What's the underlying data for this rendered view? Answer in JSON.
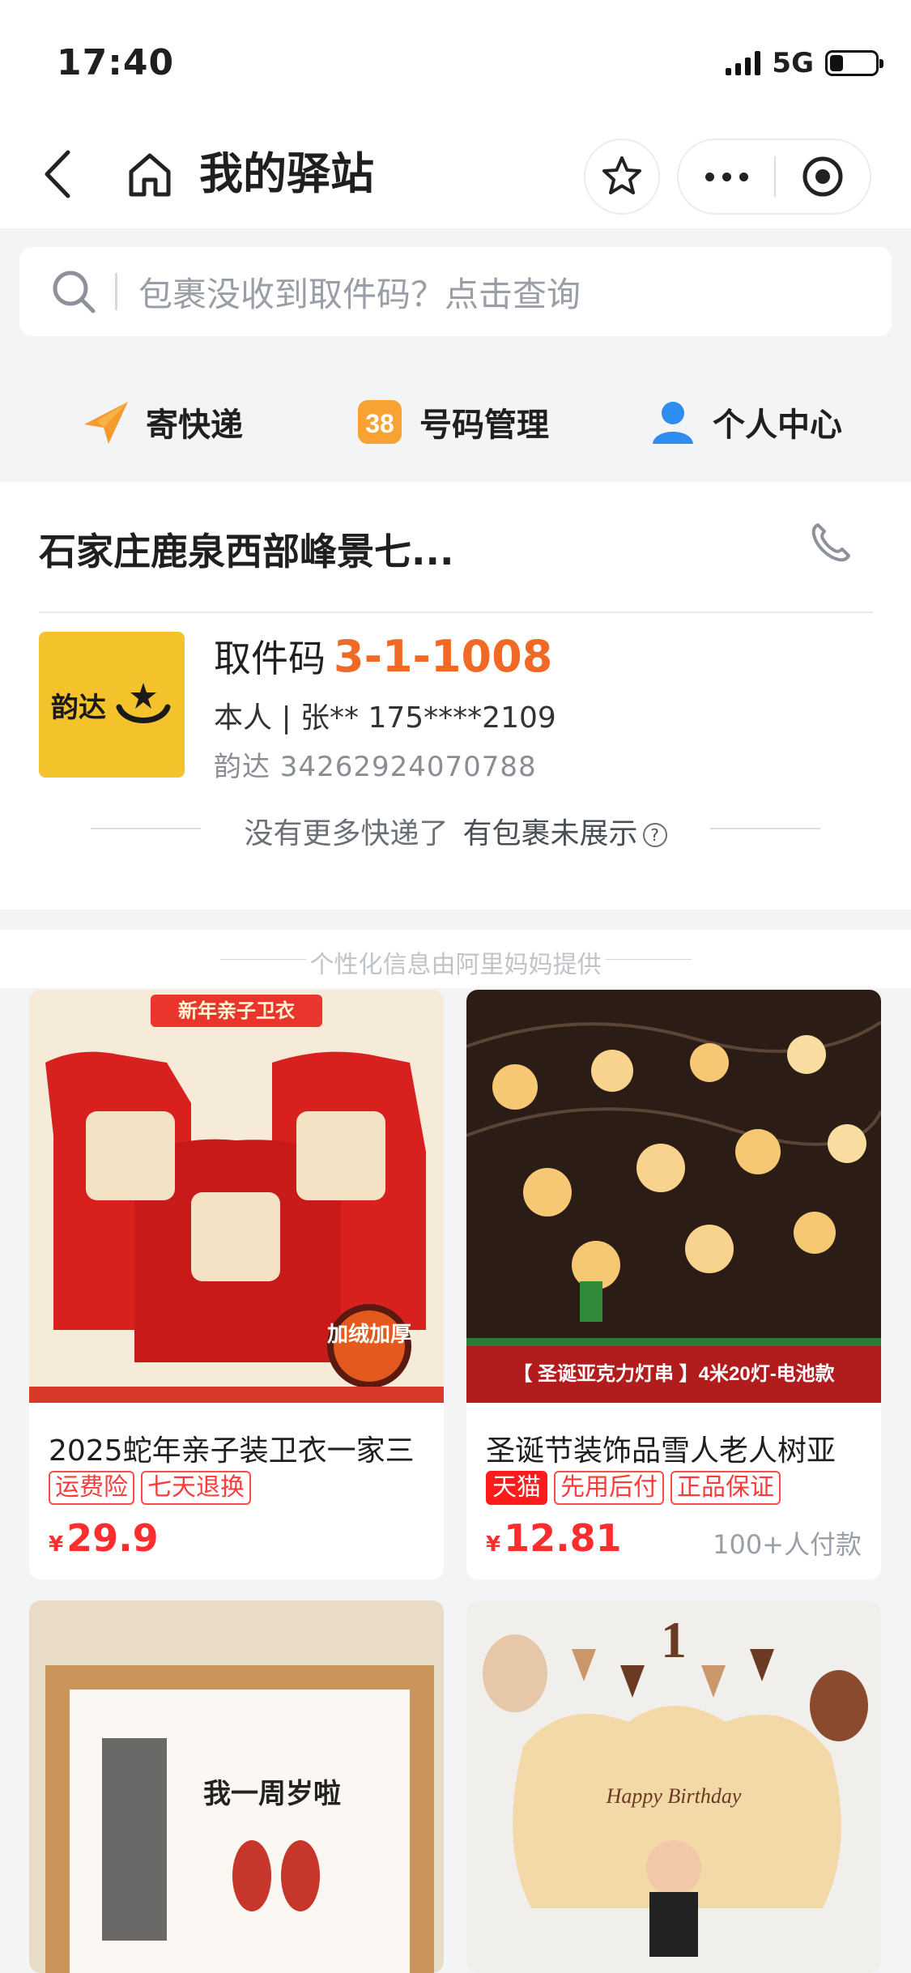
{
  "status_bar": {
    "time": "17:40",
    "network": "5G"
  },
  "nav": {
    "title": "我的驿站"
  },
  "search": {
    "placeholder": "包裹没收到取件码？点击查询"
  },
  "quick_actions": [
    {
      "label": "寄快递",
      "icon": "send-icon"
    },
    {
      "label": "号码管理",
      "icon": "number-icon"
    },
    {
      "label": "个人中心",
      "icon": "user-icon"
    }
  ],
  "station": {
    "name": "石家庄鹿泉西部峰景七...",
    "courier_logo_text": "韵达",
    "pickup_label": "取件码",
    "pickup_code": "3-1-1008",
    "owner": "本人 | 张** 175****2109",
    "tracking": "韵达 34262924070788",
    "no_more_text": "没有更多快递了",
    "unshown_link": "有包裹未展示"
  },
  "ad_header": "个性化信息由阿里妈妈提供",
  "products": [
    {
      "title": "2025蛇年亲子装卫衣一家三",
      "tags": [
        "运费险",
        "七天退换"
      ],
      "tmall": false,
      "currency": "¥",
      "price": "29.9",
      "sold": "",
      "img_banner": "新年亲子卫衣",
      "img_badge": "加绒加厚"
    },
    {
      "title": "圣诞节装饰品雪人老人树亚",
      "tags": [
        "先用后付",
        "正品保证"
      ],
      "tmall": true,
      "tmall_label": "天猫",
      "currency": "¥",
      "price": "12.81",
      "sold": "100+人付款",
      "img_banner": "【 圣诞亚克力灯串 】4米20灯-电池款"
    },
    {
      "title": "",
      "img_text": "我一周岁啦"
    },
    {
      "title": "",
      "img_text": "Happy Birthday",
      "img_number": "1"
    }
  ],
  "colors": {
    "accent": "#f06a26",
    "price": "#ff2d2d",
    "courier": "#f4c22b",
    "tmall": "#ff1b1b"
  }
}
